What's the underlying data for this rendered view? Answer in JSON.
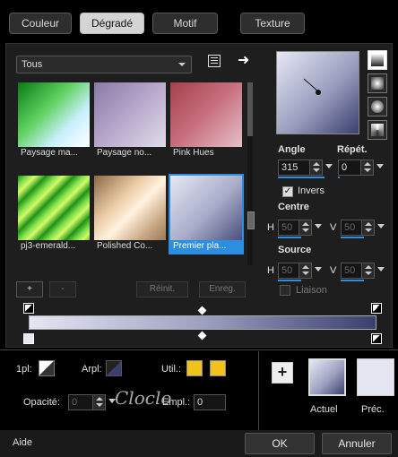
{
  "tabs": [
    {
      "label": "Couleur"
    },
    {
      "label": "Dégradé"
    },
    {
      "label": "Motif"
    },
    {
      "label": "Texture"
    }
  ],
  "library": {
    "selected": "Tous",
    "thumbnails": [
      {
        "label": "Paysage ma..."
      },
      {
        "label": "Paysage no..."
      },
      {
        "label": "Pink Hues"
      },
      {
        "label": "pj3-emerald..."
      },
      {
        "label": "Polished Co..."
      },
      {
        "label": "Premier pla..."
      }
    ],
    "add_label": "+",
    "remove_label": "-",
    "reset_label": "Réinit.",
    "save_label": "Enreg."
  },
  "params": {
    "angle_label": "Angle",
    "angle_value": "315",
    "repeat_label": "Répét.",
    "repeat_value": "0",
    "invert_label": "Invers",
    "center_label": "Centre",
    "center_h_label": "H",
    "center_h_value": "50",
    "center_v_label": "V",
    "center_v_value": "50",
    "source_label": "Source",
    "source_h_label": "H",
    "source_h_value": "50",
    "source_v_label": "V",
    "source_v_value": "50",
    "link_label": "Liaison"
  },
  "bottom": {
    "opl_label": "1pl:",
    "arpl_label": "Arpl:",
    "util_label": "Util.:",
    "opacity_label": "Opacité:",
    "opacity_value": "0",
    "empl_label": "Empl.:",
    "empl_value": "0",
    "add_label": "+",
    "current_label": "Actuel",
    "previous_label": "Préc.",
    "watermark": "Cloclo"
  },
  "footer": {
    "help_label": "Aide",
    "ok_label": "OK",
    "cancel_label": "Annuler"
  },
  "colors": {
    "accent": "#2d8de0",
    "gradient_dark": "#3a3f6e",
    "gradient_light": "#e4e6f2",
    "swatch_yellow": "#f2c21b"
  }
}
